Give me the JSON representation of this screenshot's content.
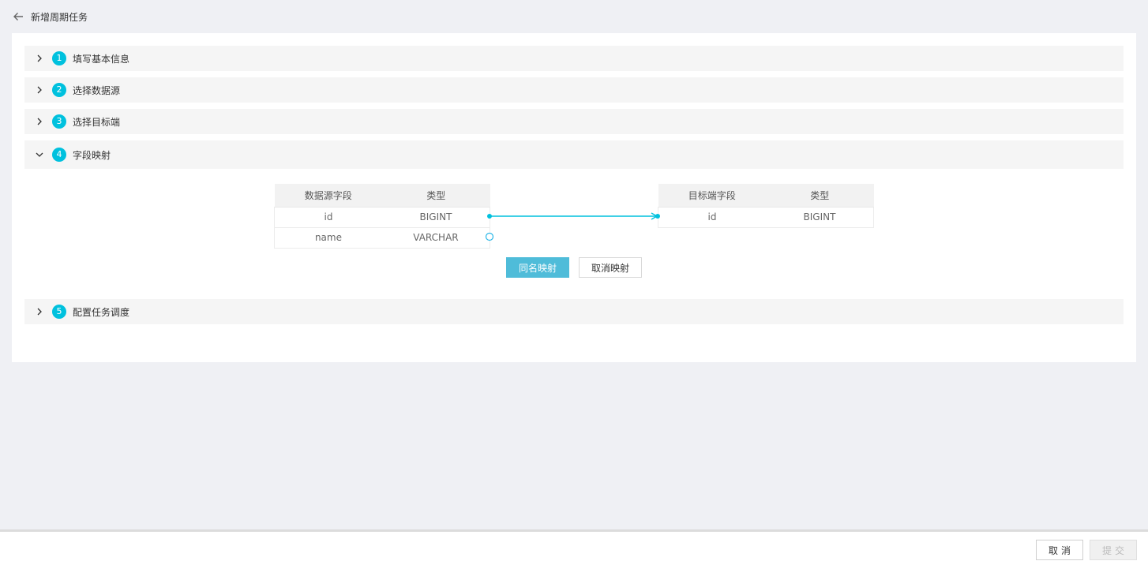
{
  "header": {
    "title": "新增周期任务"
  },
  "steps": [
    {
      "num": "1",
      "label": "填写基本信息",
      "expanded": false
    },
    {
      "num": "2",
      "label": "选择数据源",
      "expanded": false
    },
    {
      "num": "3",
      "label": "选择目标端",
      "expanded": false
    },
    {
      "num": "4",
      "label": "字段映射",
      "expanded": true
    },
    {
      "num": "5",
      "label": "配置任务调度",
      "expanded": false
    }
  ],
  "mapping": {
    "source": {
      "headers": [
        "数据源字段",
        "类型"
      ],
      "rows": [
        {
          "field": "id",
          "type": "BIGINT",
          "connected": true
        },
        {
          "field": "name",
          "type": "VARCHAR",
          "connected": false
        }
      ]
    },
    "target": {
      "headers": [
        "目标端字段",
        "类型"
      ],
      "rows": [
        {
          "field": "id",
          "type": "BIGINT"
        }
      ]
    },
    "same_name_label": "同名映射",
    "cancel_mapping_label": "取消映射"
  },
  "footer": {
    "cancel_label": "取消",
    "submit_label": "提交"
  },
  "colors": {
    "accent": "#00c1de",
    "primary_button": "#4fbcd9",
    "background": "#eff0f4"
  }
}
